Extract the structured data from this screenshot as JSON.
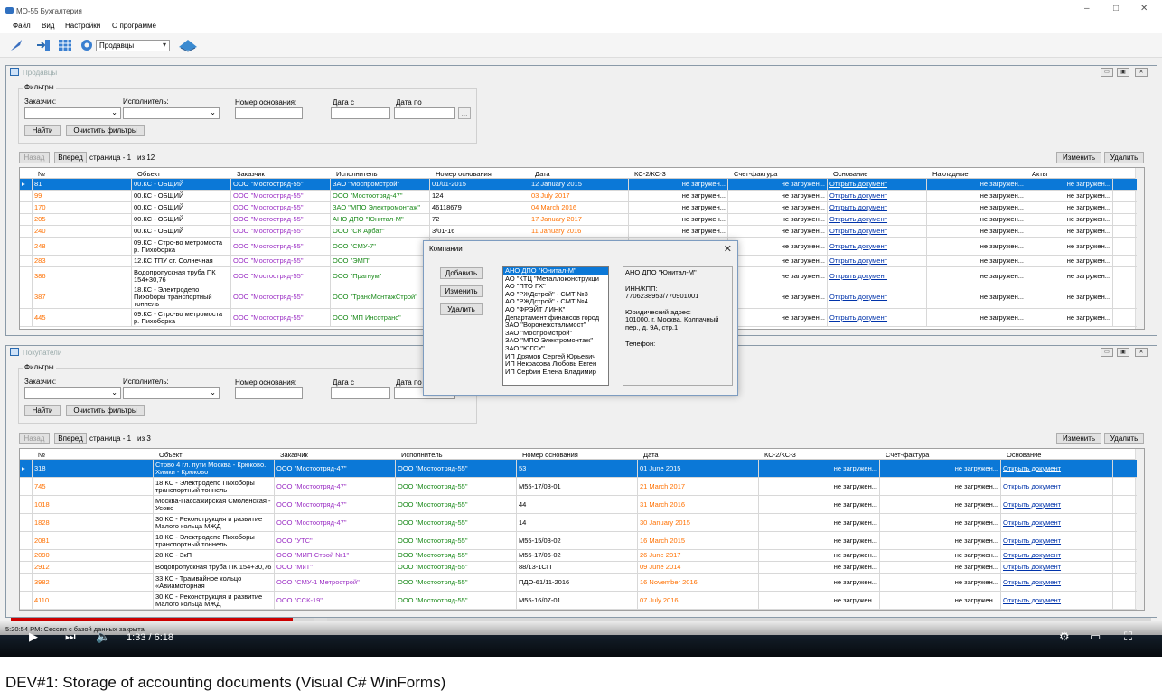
{
  "window": {
    "title": "МО-55 Бухгалтерия",
    "min": "–",
    "max": "□",
    "close": "✕"
  },
  "menu": [
    "Файл",
    "Вид",
    "Настройки",
    "О программе"
  ],
  "toolbar": {
    "combo_value": "Продавцы"
  },
  "sellers": {
    "title": "Продавцы",
    "filters_label": "Фильтры",
    "customer_label": "Заказчик:",
    "executor_label": "Исполнитель:",
    "basis_label": "Номер основания:",
    "date_from_label": "Дата с",
    "date_to_label": "Дата по",
    "find": "Найти",
    "clear": "Очистить фильтры",
    "ellipsis": "...",
    "back": "Назад",
    "forward": "Вперед",
    "page": "страница - 1",
    "of": "из 12",
    "edit": "Изменить",
    "delete": "Удалить",
    "columns": [
      "№",
      "Объект",
      "Заказчик",
      "Исполнитель",
      "Номер основания",
      "Дата",
      "КС-2/КС-3",
      "Счет-фактура",
      "Основание",
      "Накладные",
      "Акты"
    ],
    "rows": [
      [
        "81",
        "00.КС - ОБЩИЙ",
        "ООО \"Мостоотряд-55\"",
        "ЗАО \"Моспромстрой\"",
        "01/01-2015",
        "12 January 2015",
        "не загружен...",
        "не загружен...",
        "Открыть документ",
        "не загружен...",
        "не загружен..."
      ],
      [
        "99",
        "00.КС - ОБЩИЙ",
        "ООО \"Мостоотряд-55\"",
        "ООО \"Мостоотряд-47\"",
        "124",
        "03 July 2017",
        "не загружен...",
        "не загружен...",
        "Открыть документ",
        "не загружен...",
        "не загружен..."
      ],
      [
        "170",
        "00.КС - ОБЩИЙ",
        "ООО \"Мостоотряд-55\"",
        "ЗАО \"МПО Электромонтаж\"",
        "46118679",
        "04 March 2016",
        "не загружен...",
        "не загружен...",
        "Открыть документ",
        "не загружен...",
        "не загружен..."
      ],
      [
        "205",
        "00.КС - ОБЩИЙ",
        "ООО \"Мостоотряд-55\"",
        "АНО ДПО \"Юнитал-М\"",
        "72",
        "17 January 2017",
        "не загружен...",
        "не загружен...",
        "Открыть документ",
        "не загружен...",
        "не загружен..."
      ],
      [
        "240",
        "00.КС - ОБЩИЙ",
        "ООО \"Мостоотряд-55\"",
        "ООО \"СК Арбат\"",
        "3/01-16",
        "11 January 2016",
        "не загружен...",
        "не загружен...",
        "Открыть документ",
        "не загружен...",
        "не загружен..."
      ],
      [
        "248",
        "09.КС - Стро-во метромоста р. Пихоборка",
        "ООО \"Мостоотряд-55\"",
        "ООО \"СМУ-7\"",
        "",
        "",
        "",
        "не загружен...",
        "Открыть документ",
        "не загружен...",
        "не загружен..."
      ],
      [
        "283",
        "12.КС ТПУ ст. Солнечная",
        "ООО \"Мостоотряд-55\"",
        "ООО \"ЭМП\"",
        "",
        "",
        "",
        "не загружен...",
        "Открыть документ",
        "не загружен...",
        "не загружен..."
      ],
      [
        "386",
        "Водопропускная труба ПК 154+30,76",
        "ООО \"Мостоотряд-55\"",
        "ООО \"Прагнум\"",
        "",
        "",
        "",
        "не загружен...",
        "Открыть документ",
        "не загружен...",
        "не загружен..."
      ],
      [
        "387",
        "18.КС - Электродепо Пихоборы транспортный тоннель",
        "ООО \"Мостоотряд-55\"",
        "ООО \"ТрансМонтажСтрой\"",
        "",
        "",
        "",
        "не загружен...",
        "Открыть документ",
        "не загружен...",
        "не загружен..."
      ],
      [
        "445",
        "09.КС - Стро-во метромоста р. Пихоборка",
        "ООО \"Мостоотряд-55\"",
        "ООО \"МП Инсотранс\"",
        "",
        "",
        "",
        "не загружен...",
        "Открыть документ",
        "не загружен...",
        "не загружен..."
      ]
    ]
  },
  "buyers": {
    "title": "Покупатели",
    "filters_label": "Фильтры",
    "customer_label": "Заказчик:",
    "executor_label": "Исполнитель:",
    "basis_label": "Номер основания:",
    "date_from_label": "Дата с",
    "date_to_label": "Дата по",
    "find": "Найти",
    "clear": "Очистить фильтры",
    "back": "Назад",
    "forward": "Вперед",
    "page": "страница - 1",
    "of": "из 3",
    "edit": "Изменить",
    "delete": "Удалить",
    "columns": [
      "№",
      "Объект",
      "Заказчик",
      "Исполнитель",
      "Номер основания",
      "Дата",
      "КС-2/КС-3",
      "Счет-фактура",
      "Основание"
    ],
    "rows": [
      [
        "318",
        "Стрво 4 гл. пути Москва - Крюково. Химки - Крюково",
        "ООО \"Мостоотряд-47\"",
        "ООО \"Мостоотряд-55\"",
        "53",
        "01 June 2015",
        "не загружен...",
        "не загружен...",
        "Открыть документ"
      ],
      [
        "745",
        "18.КС - Электродепо Пихоборы транспортный тоннель",
        "ООО \"Мостоотряд-47\"",
        "ООО \"Мостоотряд-55\"",
        "М55-17/03-01",
        "21 March 2017",
        "не загружен...",
        "не загружен...",
        "Открыть документ"
      ],
      [
        "1018",
        "Москва-Пассажирская Смоленская - Усово",
        "ООО \"Мостоотряд-47\"",
        "ООО \"Мостоотряд-55\"",
        "44",
        "31 March 2016",
        "не загружен...",
        "не загружен...",
        "Открыть документ"
      ],
      [
        "1828",
        "30.КС - Реконструкция и развитие Малого кольца МЖД",
        "ООО \"Мостоотряд-47\"",
        "ООО \"Мостоотряд-55\"",
        "14",
        "30 January 2015",
        "не загружен...",
        "не загружен...",
        "Открыть документ"
      ],
      [
        "2081",
        "18.КС - Электродепо Пихоборы транспортный тоннель",
        "ООО \"УТС\"",
        "ООО \"Мостоотряд-55\"",
        "М55-15/03-02",
        "16 March 2015",
        "не загружен...",
        "не загружен...",
        "Открыть документ"
      ],
      [
        "2090",
        "28.КС - ЗкП",
        "ООО \"МИП-Строй №1\"",
        "ООО \"Мостоотряд-55\"",
        "М55-17/06-02",
        "26 June 2017",
        "не загружен...",
        "не загружен...",
        "Открыть документ"
      ],
      [
        "2912",
        "Водопропускная труба ПК 154+30,76",
        "ООО \"МиТ\"",
        "ООО \"Мостоотряд-55\"",
        "88/13-1СП",
        "09 June 2014",
        "не загружен...",
        "не загружен...",
        "Открыть документ"
      ],
      [
        "3982",
        "33.КС - Трамвайное кольцо «Авиамоторная",
        "ООО \"СМУ-1 Метрострой\"",
        "ООО \"Мостоотряд-55\"",
        "ПДО-61/11-2016",
        "16 November 2016",
        "не загружен...",
        "не загружен...",
        "Открыть документ"
      ],
      [
        "4110",
        "30.КС - Реконструкция и развитие Малого кольца МЖД",
        "ООО \"ССК-19\"",
        "ООО \"Мостоотряд-55\"",
        "М55-16/07-01",
        "07 July 2016",
        "не загружен...",
        "не загружен...",
        "Открыть документ"
      ]
    ]
  },
  "dialog": {
    "title": "Компании",
    "add": "Добавить",
    "edit": "Изменить",
    "delete": "Удалить",
    "items": [
      "АНО ДПО \"Юнитал-М\"",
      "АО \"КТЦ \"Металлоконструкци",
      "АО \"ПТО ГХ\"",
      "АО \"РЖДстрой\" - СМТ №3",
      "АО \"РЖДстрой\" - СМТ №4",
      "АО \"ФРЭЙТ ЛИНК\"",
      "Департамент финансов город",
      "ЗАО \"Воронежстальмост\"",
      "ЗАО \"Моспромстрой\"",
      "ЗАО \"МПО Электромонтаж\"",
      "ЗАО \"ЮГСУ\"",
      "ИП Дрямов Сергей Юрьевич",
      "ИП Некрасова Любовь Евген",
      "ИП Сербин Елена Владимир"
    ],
    "info": {
      "name": "АНО ДПО \"Юнитал-М\"",
      "inn_label": "ИНН/КПП:",
      "inn": "7706238953/770901001",
      "address_label": "Юридический адрес:",
      "address": "101000, г. Москва, Колпачный пер., д. 9А, стр.1",
      "phone_label": "Телефон:"
    }
  },
  "status": "5:20:54 PM: Сессия с базой данных закрыта",
  "player": {
    "time": "1:33 / 6:18",
    "progress": 0.247
  },
  "caption": "DEV#1: Storage of accounting documents (Visual C# WinForms)"
}
